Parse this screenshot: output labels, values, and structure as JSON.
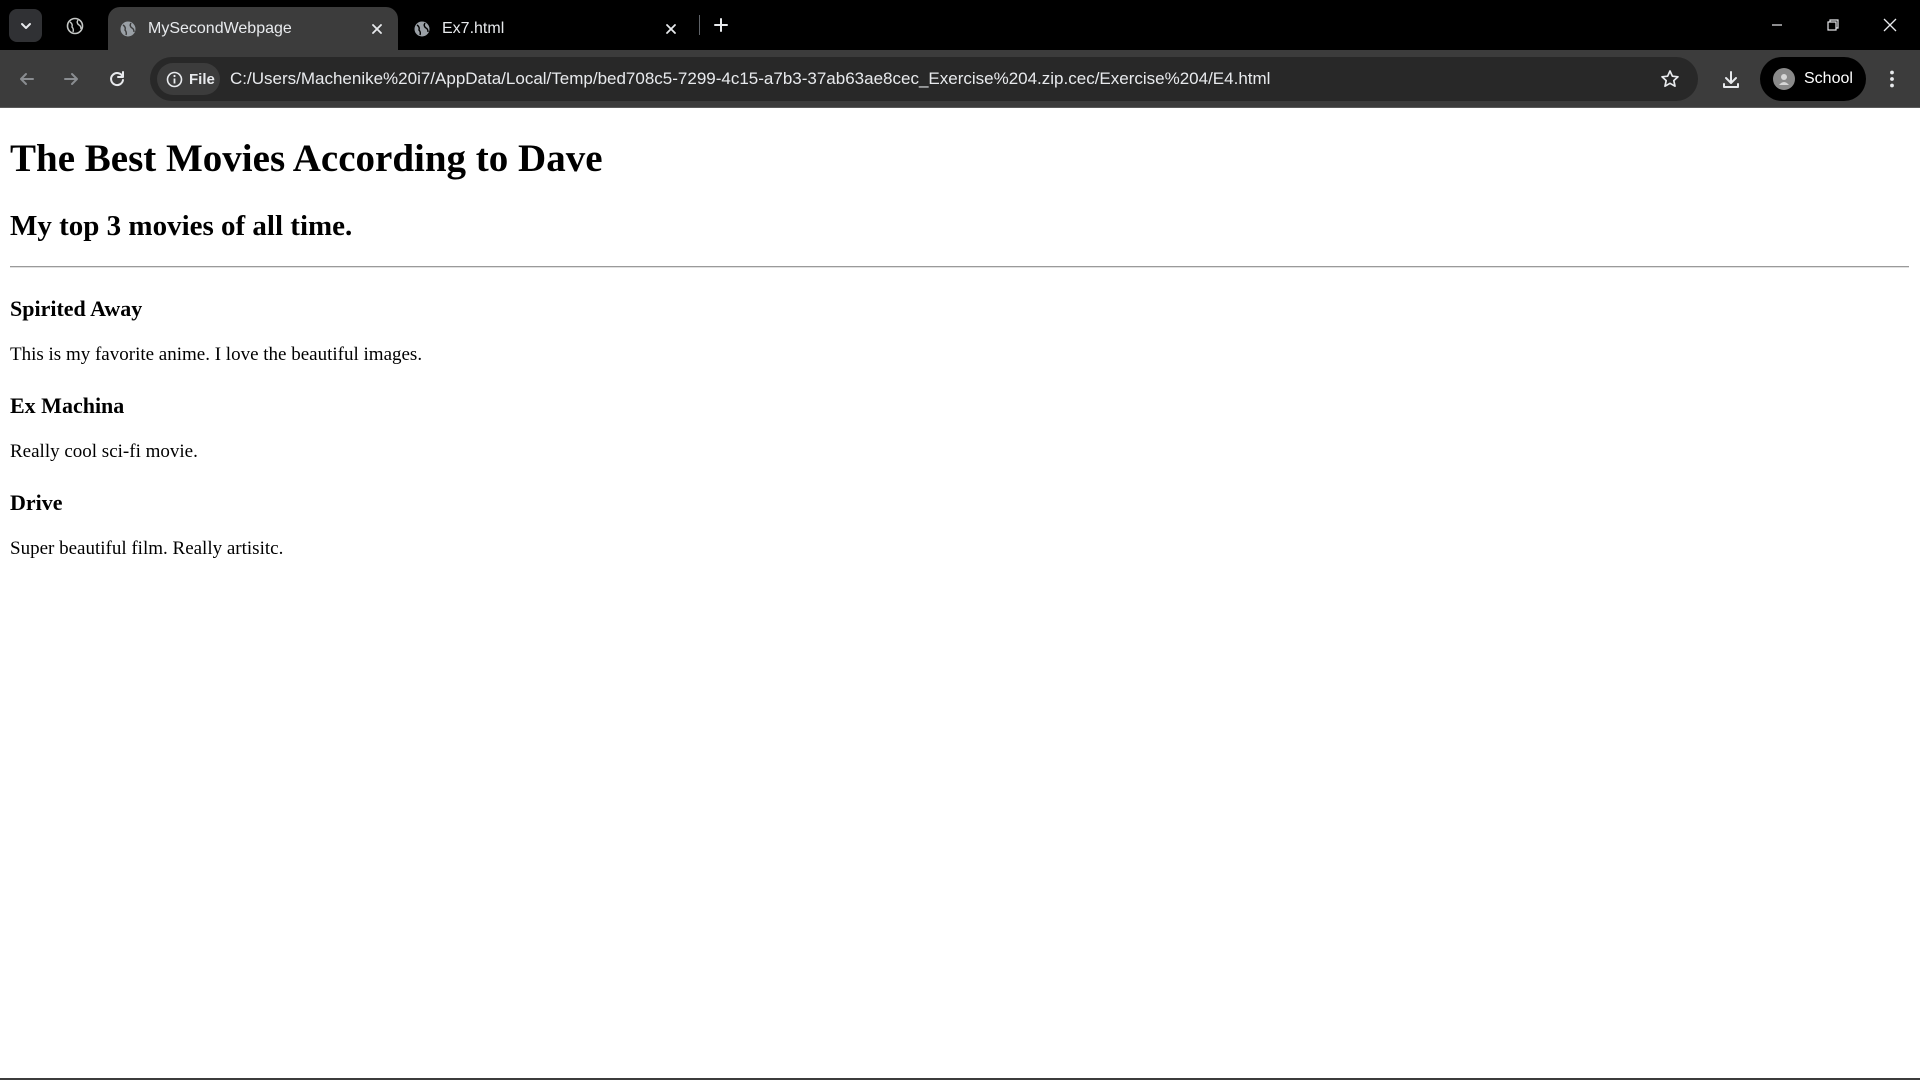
{
  "browser": {
    "tabs": [
      {
        "title": "MySecondWebpage",
        "active": true
      },
      {
        "title": "Ex7.html",
        "active": false
      }
    ],
    "address": {
      "scheme_chip": "File",
      "url": "C:/Users/Machenike%20i7/AppData/Local/Temp/bed708c5-7299-4c15-a7b3-37ab63ae8cec_Exercise%204.zip.cec/Exercise%204/E4.html"
    },
    "profile": {
      "name": "School"
    },
    "colors": {
      "chrome_bg": "#000000",
      "toolbar_bg": "#3c3c3c",
      "omnibox_bg": "#282828",
      "text": "#e8eaed"
    }
  },
  "page": {
    "heading": "The Best Movies According to Dave",
    "subheading": "My top 3 movies of all time.",
    "movies": [
      {
        "title": "Spirited Away",
        "description": "This is my favorite anime. I love the beautiful images."
      },
      {
        "title": "Ex Machina",
        "description": "Really cool sci-fi movie."
      },
      {
        "title": "Drive",
        "description": "Super beautiful film. Really artisitc."
      }
    ]
  },
  "icons": {
    "tab_search": "chevron-down-icon",
    "tab_group": "globe-icon",
    "new_tab": "plus-icon",
    "back": "arrow-left-icon",
    "forward": "arrow-right-icon",
    "reload": "reload-icon",
    "site_info": "info-icon",
    "bookmark": "star-icon",
    "downloads": "download-icon",
    "menu": "kebab-menu-icon"
  }
}
